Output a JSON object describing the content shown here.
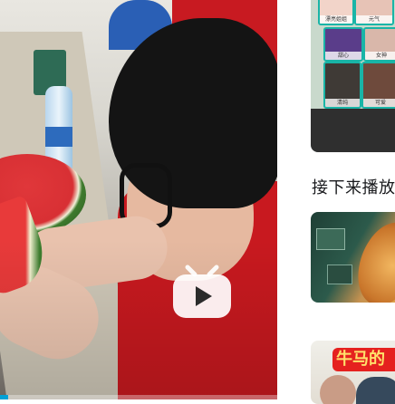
{
  "player": {
    "progress_fraction": 0.03,
    "play_icon": "play-icon"
  },
  "sidebar": {
    "section_title": "接下来播放",
    "top_thumb_tags": [
      "漂亮姐姐",
      "元气",
      "甜心",
      "女神",
      "清纯",
      "可爱"
    ],
    "videos": [
      {
        "thumb_desc": "circuit-board"
      },
      {
        "badge_text": "牛马的"
      }
    ]
  },
  "colors": {
    "accent": "#00a1d6",
    "grid_border": "#19b5a7",
    "badge_bg": "#e5211f",
    "badge_text": "#ffe16b"
  }
}
